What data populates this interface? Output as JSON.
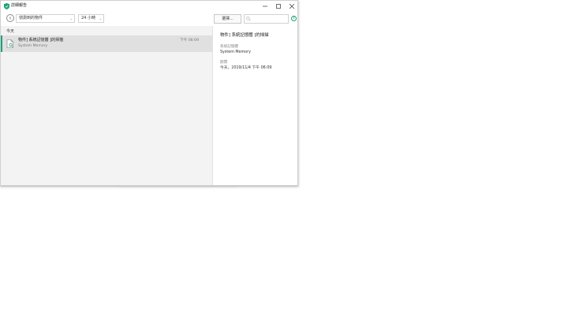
{
  "window": {
    "title": "詳細報告",
    "accent": "#1aa179",
    "icons": {
      "app": "shield-icon",
      "minimize": "minimize-icon",
      "maximize": "maximize-icon",
      "close": "close-icon"
    }
  },
  "toolbar": {
    "category_filter": "偵測到的物件",
    "period_filter": "24 小時",
    "select_button": "選擇...",
    "search_placeholder": "",
    "icons": {
      "filter": "filter-icon",
      "search": "search-icon",
      "help": "help-icon"
    }
  },
  "list": {
    "group_label": "今天",
    "items": [
      {
        "title": "物件] 系統記憶體 ]的掃描",
        "subtitle": "System Memory",
        "time": "下午 06:09",
        "icon": "document-scan-icon"
      }
    ]
  },
  "details": {
    "title": "物件] 系統記憶體 ]的掃描",
    "fields": [
      {
        "label": "系統記憶體",
        "value": "System Memory"
      },
      {
        "label": "期間",
        "value": "今天，2019/11/4 下午 06:09"
      }
    ]
  }
}
